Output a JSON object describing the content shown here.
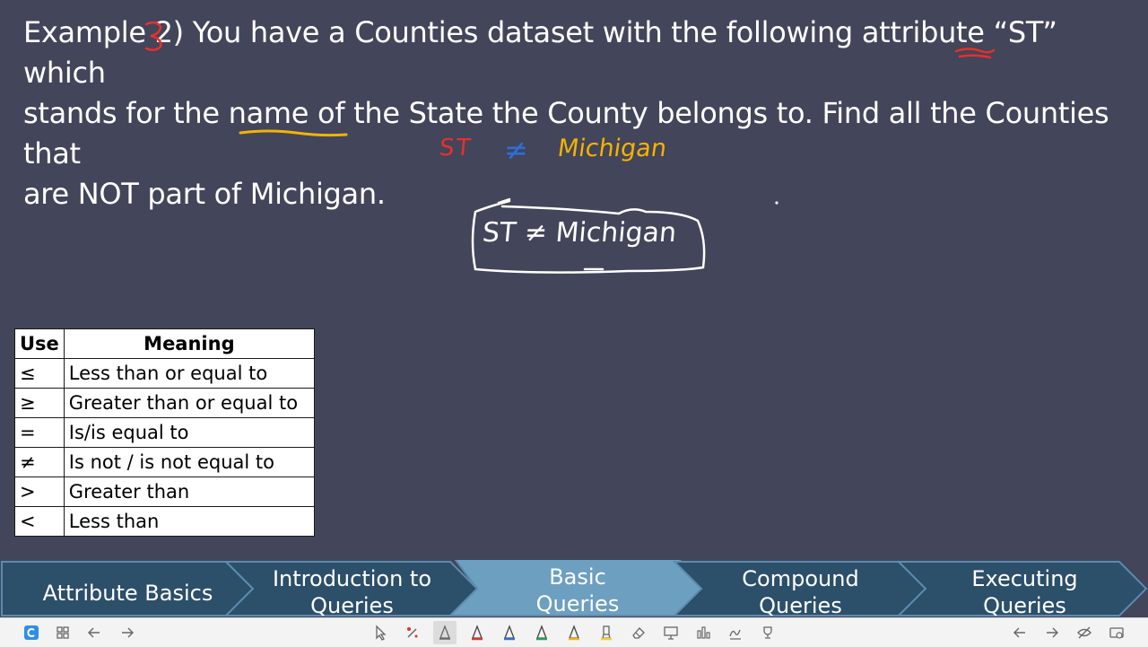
{
  "slide": {
    "line1_a": "Example ",
    "line1_num": "2",
    "line1_b": ") You have a Counties dataset with the following attribute “",
    "line1_st": "ST",
    "line1_c": "” which",
    "line2": "stands for the name of the State the County belongs to. Find all the Counties that",
    "line3_a": "are NOT part of ",
    "line3_michigan": "Michigan",
    "line3_b": "."
  },
  "annotations": {
    "st": "ST",
    "neq": "≠",
    "michigan": "Michigan",
    "box_expr": "ST ≠ Michigan"
  },
  "table": {
    "headers": [
      "Use",
      "Meaning"
    ],
    "rows": [
      {
        "symbol": "≤",
        "meaning": "Less than or equal to"
      },
      {
        "symbol": "≥",
        "meaning": "Greater than or equal to"
      },
      {
        "symbol": "=",
        "meaning": "Is/is equal to"
      },
      {
        "symbol": "≠",
        "meaning": "Is not / is not equal to"
      },
      {
        "symbol": ">",
        "meaning": "Greater than"
      },
      {
        "symbol": "<",
        "meaning": "Less than"
      }
    ]
  },
  "nav": {
    "steps": [
      {
        "line1": "Attribute Basics",
        "line2": ""
      },
      {
        "line1": "Introduction to",
        "line2": "Queries"
      },
      {
        "line1": "Basic",
        "line2": "Queries"
      },
      {
        "line1": "Compound",
        "line2": "Queries"
      },
      {
        "line1": "Executing",
        "line2": "Queries"
      }
    ],
    "active_index": 2,
    "colors": {
      "normal": "#2c4f6a",
      "active": "#6d9fc1",
      "edge": "#5c8cb0"
    }
  },
  "toolbar": {
    "app_icon": "app-logo-icon",
    "left": [
      "grid-icon",
      "back-arrow-icon",
      "forward-arrow-icon"
    ],
    "center": [
      "pointer-icon",
      "laser-pen-icon",
      "pen-icon",
      "red-pen-icon",
      "blue-pen-icon",
      "green-pen-icon",
      "yellow-pen-icon",
      "highlighter-icon",
      "eraser-icon",
      "whiteboard-icon",
      "chart-icon",
      "signature-icon",
      "trophy-icon"
    ],
    "right": [
      "back-arrow-icon",
      "forward-arrow-icon",
      "hide-icon",
      "settings-icon"
    ]
  },
  "colors": {
    "background": "#43455a",
    "ink_red": "#e8302a",
    "ink_blue": "#2d6fd6",
    "ink_yellow": "#f5b300",
    "ink_white": "#ffffff"
  }
}
